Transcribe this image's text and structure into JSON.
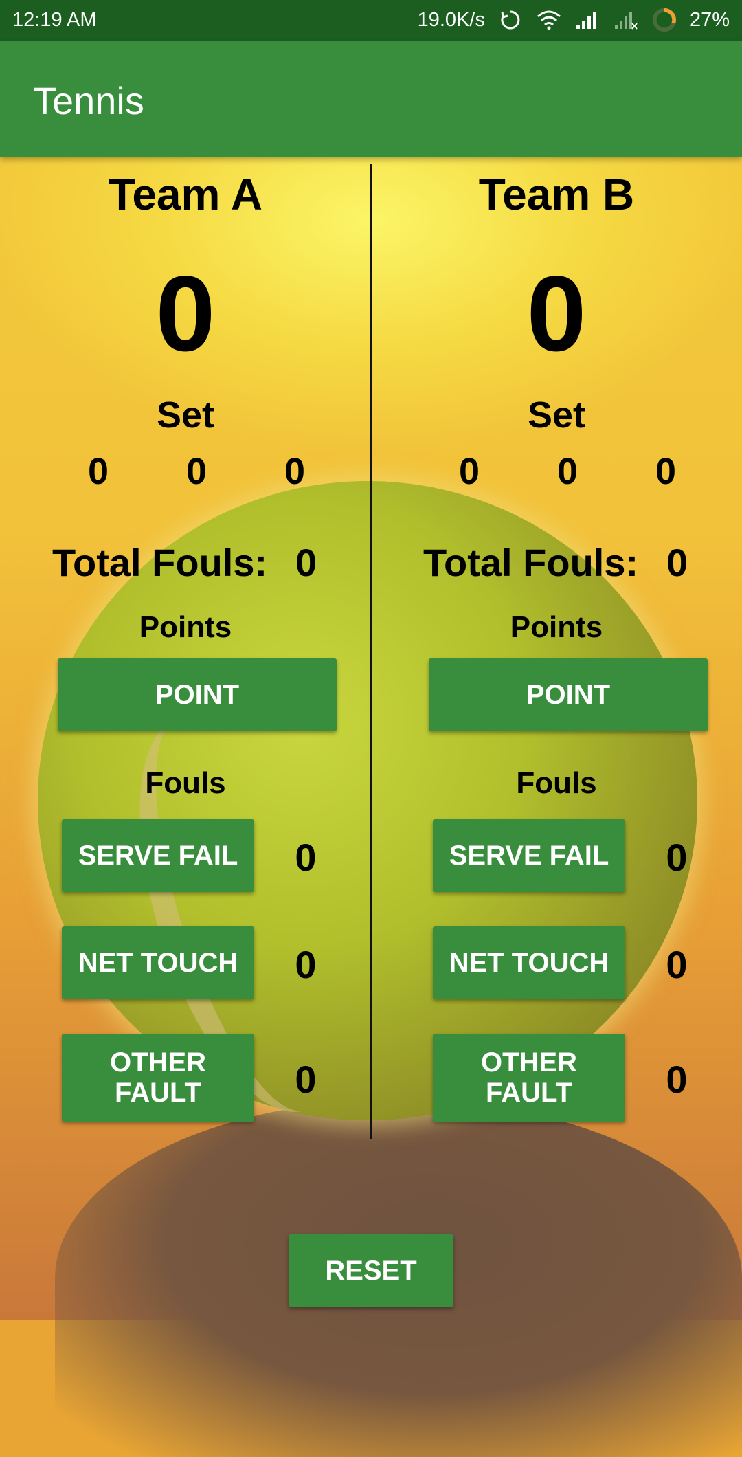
{
  "status_bar": {
    "time": "12:19 AM",
    "network_speed": "19.0K/s",
    "battery": "27%",
    "icons": [
      "sync-icon",
      "wifi-icon",
      "signal-icon",
      "signal-no-sim-icon",
      "battery-ring-icon"
    ]
  },
  "app_bar": {
    "title": "Tennis"
  },
  "team_a": {
    "name": "Team A",
    "score": "0",
    "set_label": "Set",
    "sets": [
      "0",
      "0",
      "0"
    ],
    "total_fouls_label": "Total Fouls:",
    "total_fouls": "0",
    "points_label": "Points",
    "point_button": "POINT",
    "fouls_label": "Fouls",
    "fouls": [
      {
        "label": "SERVE FAIL",
        "count": "0"
      },
      {
        "label": "NET TOUCH",
        "count": "0"
      },
      {
        "label": "OTHER FAULT",
        "count": "0"
      }
    ]
  },
  "team_b": {
    "name": "Team B",
    "score": "0",
    "set_label": "Set",
    "sets": [
      "0",
      "0",
      "0"
    ],
    "total_fouls_label": "Total Fouls:",
    "total_fouls": "0",
    "points_label": "Points",
    "point_button": "POINT",
    "fouls_label": "Fouls",
    "fouls": [
      {
        "label": "SERVE FAIL",
        "count": "0"
      },
      {
        "label": "NET TOUCH",
        "count": "0"
      },
      {
        "label": "OTHER FAULT",
        "count": "0"
      }
    ]
  },
  "reset_button": "RESET",
  "colors": {
    "status_bar": "#1b5e20",
    "app_bar": "#388e3c",
    "button": "#388e3c"
  }
}
